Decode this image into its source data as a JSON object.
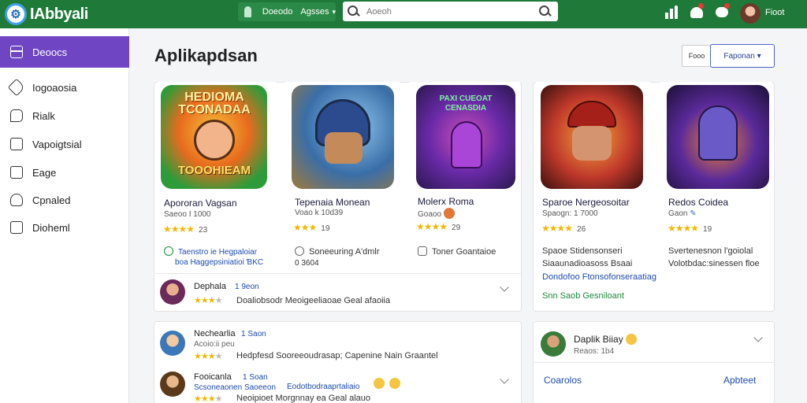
{
  "app": {
    "name": "IAbbyali"
  },
  "topbar": {
    "tab_a": "Doeodo",
    "tab_b": "Agsses",
    "search_placeholder": "Aoeoh",
    "user_name": "Fioot"
  },
  "sidebar": {
    "items": [
      {
        "label": "Deoocs",
        "icon": "layout-icon"
      },
      {
        "label": "Iogoaosia",
        "icon": "tag-icon"
      },
      {
        "label": "Rialk",
        "icon": "chat-bubble-icon"
      },
      {
        "label": "Vapoigtsial",
        "icon": "document-icon"
      },
      {
        "label": "Eage",
        "icon": "image-icon"
      },
      {
        "label": "Cpnaled",
        "icon": "cloud-icon"
      },
      {
        "label": "Dioheml",
        "icon": "grid-icon"
      }
    ]
  },
  "main": {
    "title": "Aplikapdsan",
    "small_button": "Fooo",
    "dropdown_label": "Faponan"
  },
  "cards": [
    {
      "art_title": "HEDIOMA TCONADAA",
      "art_bottom": "TOOOHIEAM",
      "name": "Apororan Vagsan",
      "meta": "Saeoo I 1000",
      "rating": "23",
      "line1": "Taenstro ie Hegpaloiar",
      "line2": "boa Haggepsiniatioi ƁKC"
    },
    {
      "name": "Tepenaia Monean",
      "meta": "Voao k 10d39",
      "rating": "19",
      "line1": "Soneeuring A'dmlr",
      "line2": "0 3604"
    },
    {
      "art_title": "PAXI CUEOAT CENASDIA",
      "name": "Molerx Roma",
      "meta": "Goaoo",
      "rating": "29",
      "line1": "Toner Goantaioe"
    },
    {
      "name": "Sparoe Nergeosoitar",
      "meta": "Spaogn: 1 7000",
      "rating": "26",
      "line1": "Spaoe Stidensonseri",
      "line2": "Siaaunadioasoss Bsaai",
      "line3": "Dondofoo Ftonsofonseraatiag",
      "line4": "Snn  Saob Gesniloant"
    },
    {
      "name": "Redos Coidea",
      "meta": "Gaon",
      "rating": "19",
      "line1": "Svertenesnon l'goiolal",
      "line2": "Volotbdac:sinessen floe"
    }
  ],
  "rows": [
    {
      "name": "Dephala",
      "sub": "1 9eon",
      "text": "Doaliobsodr Meoigeeliaoae Geal afaoiia"
    },
    {
      "name": "Nechearlia",
      "sub": "Acoio:ii peu",
      "time": "1 Saon",
      "text": "Hedpfesd  Sooreeoudrasap;   Capenine Nain  Graantel"
    },
    {
      "name": "Fooicanla",
      "sub": "Scsoneaonen Saoeeon",
      "time": "1 Soan",
      "extra": "Eodotbodraaprtaliaio",
      "text": "Neoipioet  Morgnnay  ea Geal alauo"
    }
  ],
  "side_panel": {
    "name": "Daplik Biiay",
    "sub": "Reaos: 1b4",
    "left_link": "Coarolos",
    "right_link": "Apbteet"
  },
  "colors": {
    "topbar": "#1f7a3a",
    "sidebar_active": "#6f45c3",
    "link": "#1e4bb0",
    "star": "#f2b705"
  }
}
